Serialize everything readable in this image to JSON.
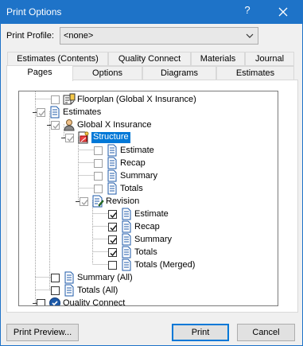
{
  "window": {
    "title": "Print Options",
    "help_glyph": "?",
    "close_icon": "close-icon",
    "accent": "#1e73c8"
  },
  "profile": {
    "label": "Print Profile:",
    "value": "<none>"
  },
  "tabs_row1": [
    "Estimates (Contents)",
    "Quality Connect",
    "Materials",
    "Journal"
  ],
  "tabs_row2": [
    "Pages",
    "Options",
    "Diagrams",
    "Estimates"
  ],
  "selected_tab": "Pages",
  "tree": {
    "items": [
      {
        "label": "Floorplan (Global X Insurance)",
        "checked": false,
        "icon": "floorplan-icon"
      },
      {
        "label": "Estimates",
        "checked": true,
        "partial": true,
        "icon": "document-icon",
        "expanded": true
      },
      {
        "label": "Global X Insurance",
        "checked": true,
        "partial": true,
        "icon": "person-icon",
        "expanded": true
      },
      {
        "label": "Structure",
        "checked": true,
        "partial": true,
        "icon": "structure-icon",
        "expanded": true,
        "selected": true
      },
      {
        "label": "Estimate",
        "checked": false,
        "icon": "document-icon"
      },
      {
        "label": "Recap",
        "checked": false,
        "icon": "document-icon"
      },
      {
        "label": "Summary",
        "checked": false,
        "icon": "document-icon"
      },
      {
        "label": "Totals",
        "checked": false,
        "icon": "document-icon"
      },
      {
        "label": "Revision",
        "checked": true,
        "partial": true,
        "icon": "revision-icon",
        "expanded": true
      },
      {
        "label": "Estimate",
        "checked": true,
        "icon": "document-icon"
      },
      {
        "label": "Recap",
        "checked": true,
        "icon": "document-icon"
      },
      {
        "label": "Summary",
        "checked": true,
        "icon": "document-icon"
      },
      {
        "label": "Totals",
        "checked": true,
        "icon": "document-icon"
      },
      {
        "label": "Totals (Merged)",
        "checked": false,
        "icon": "document-icon"
      },
      {
        "label": "Summary (All)",
        "checked": false,
        "icon": "document-icon"
      },
      {
        "label": "Totals (All)",
        "checked": false,
        "icon": "document-icon"
      },
      {
        "label": "Quality Connect",
        "checked": false,
        "icon": "quality-connect-icon",
        "expanded": true
      }
    ]
  },
  "buttons": {
    "print_preview": "Print Preview...",
    "print": "Print",
    "cancel": "Cancel"
  }
}
